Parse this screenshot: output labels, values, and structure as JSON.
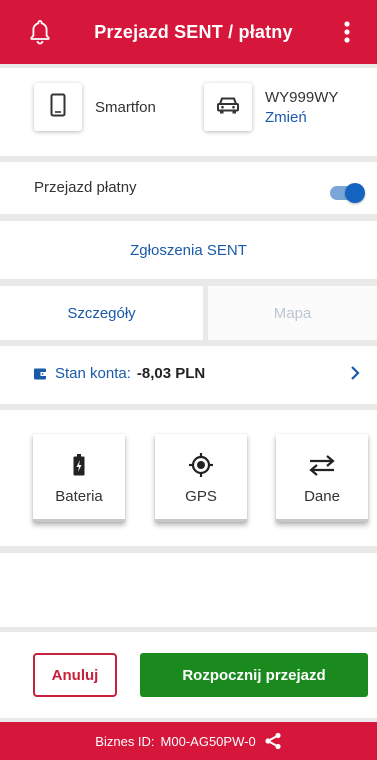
{
  "header": {
    "title": "Przejazd SENT / płatny",
    "bell_icon": "bell-icon",
    "menu_icon": "more-vert-icon"
  },
  "device": {
    "label": "Smartfon",
    "icon": "smartphone-icon"
  },
  "vehicle": {
    "plate": "WY999WY",
    "change_label": "Zmień",
    "icon": "car-icon"
  },
  "paid_ride": {
    "label": "Przejazd płatny",
    "enabled": true
  },
  "sent_reports": {
    "label": "Zgłoszenia SENT"
  },
  "tabs": [
    {
      "label": "Szczegóły",
      "active": true
    },
    {
      "label": "Mapa",
      "active": false
    }
  ],
  "balance": {
    "label": "Stan konta:",
    "amount": "-8,03 PLN"
  },
  "status": [
    {
      "label": "Bateria",
      "icon": "battery-charging-icon"
    },
    {
      "label": "GPS",
      "icon": "gps-crosshair-icon"
    },
    {
      "label": "Dane",
      "icon": "data-transfer-icon"
    }
  ],
  "actions": {
    "cancel_label": "Anuluj",
    "start_label": "Rozpocznij przejazd"
  },
  "footer": {
    "prefix": "Biznes ID:",
    "id": "M00-AG50PW-0",
    "share_icon": "share-icon"
  },
  "colors": {
    "brand_red": "#d6163a",
    "link_blue": "#1a5aa8",
    "start_green": "#1a8a1e"
  }
}
